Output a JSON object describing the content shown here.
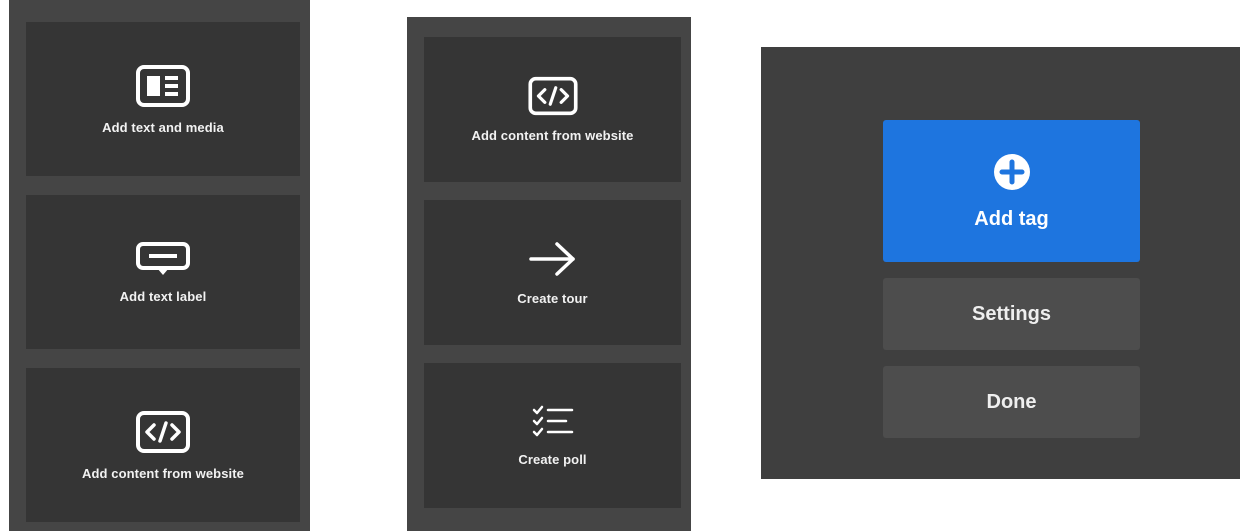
{
  "panel_left": {
    "tiles": [
      {
        "label": "Add text and media",
        "icon": "text-media-icon"
      },
      {
        "label": "Add text label",
        "icon": "text-label-icon"
      },
      {
        "label": "Add content from website",
        "icon": "code-icon"
      }
    ]
  },
  "panel_middle": {
    "tiles": [
      {
        "label": "Add content from website",
        "icon": "code-icon"
      },
      {
        "label": "Create tour",
        "icon": "arrow-right-icon"
      },
      {
        "label": "Create poll",
        "icon": "checklist-icon"
      }
    ]
  },
  "panel_right": {
    "add_tag_label": "Add tag",
    "add_tag_icon": "plus-circle-icon",
    "settings_label": "Settings",
    "done_label": "Done"
  },
  "colors": {
    "panel_bg": "#454545",
    "tile_bg": "#353535",
    "accent_blue": "#1e75df",
    "secondary_button": "#4d4d4d"
  }
}
